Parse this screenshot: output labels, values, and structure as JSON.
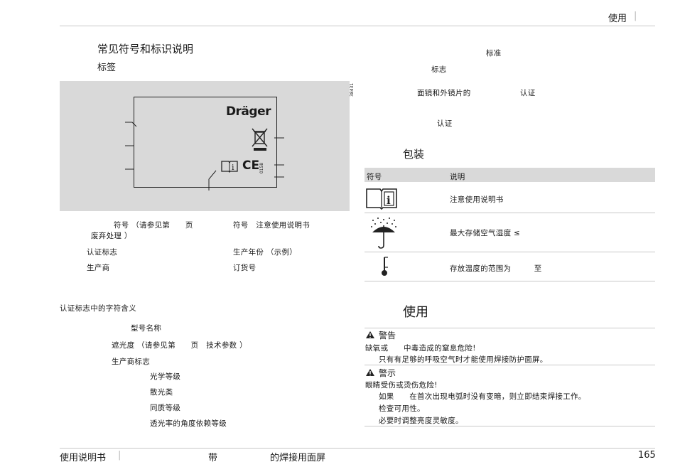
{
  "header": {
    "section": "使用",
    "separator": "|"
  },
  "left": {
    "heading": "常见符号和标识说明",
    "subheading": "标签",
    "label_image": {
      "brand": "Dräger",
      "code_vertical": "0158",
      "image_id": "38431",
      "ce_mark": "CE"
    },
    "legend": {
      "col1_row1": "符号 （请参见第　　页",
      "col1_row1b": "废弃处理 ）",
      "col2_row1": "符号　注意使用说明书",
      "col1_row2": "认证标志",
      "col2_row2": "生产年份 （示例）",
      "col1_row3": "生产商",
      "col2_row3": "订货号"
    },
    "cert_title": "认证标志中的字符含义",
    "cert_items": {
      "model": "型号名称",
      "shade": "遮光度 （请参见第　　页　技术参数 ）",
      "manufacturer": "生产商标志",
      "optical_class": "光学等级",
      "diffusion_class": "散光类",
      "homogeneity_class": "同质等级",
      "angle_class": "透光率的角度依赖等级"
    }
  },
  "right": {
    "std_label": "标准",
    "mark_label": "标志",
    "lens_cert_a": "面镜和外镜片的",
    "lens_cert_b": "认证",
    "cert_label": "认证",
    "packaging_heading": "包装",
    "table": {
      "col_symbol": "符号",
      "col_desc": "说明",
      "rows": [
        {
          "icon": "manual-icon",
          "desc": "注意使用说明书"
        },
        {
          "icon": "umbrella-rain-icon",
          "desc": "最大存储空气湿度 ≤"
        },
        {
          "icon": "thermometer-icon",
          "desc": "存放温度的范围为　　　至"
        }
      ]
    },
    "use_heading": "使用",
    "warning": {
      "title": "警告",
      "line1": "缺氧或　　中毒造成的窒息危险!",
      "line2": "只有有足够的呼吸空气时才能使用焊接防护面屏。"
    },
    "caution": {
      "title": "警示",
      "line1": "眼睛受伤或烫伤危险!",
      "line2": "如果　　在首次出现电弧时没有变暗，则立即结束焊接工作。",
      "line3": "检查可用性。",
      "line4": "必要时调整亮度灵敏度。"
    }
  },
  "footer": {
    "manual": "使用说明书",
    "separator": "|",
    "title_part1": "带",
    "title_part2": "的焊接用面屏",
    "page_number": "165"
  },
  "colors": {
    "panel_gray": "#d9d9d9",
    "rule_gray": "#c8c8c8",
    "text": "#1a1a1a"
  }
}
